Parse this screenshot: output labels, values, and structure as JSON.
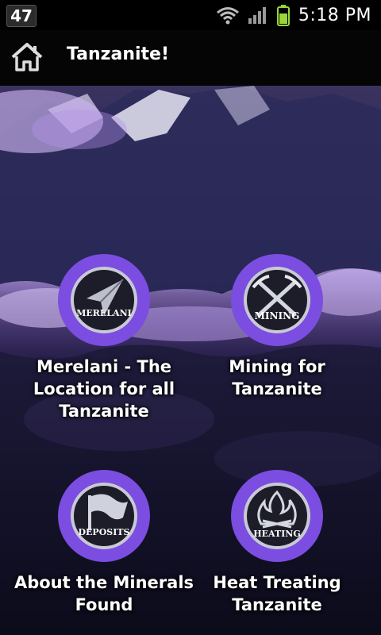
{
  "status_bar": {
    "notification_count": "47",
    "time": "5:18 PM",
    "icons": [
      "wifi-icon",
      "signal-icon",
      "battery-icon"
    ]
  },
  "action_bar": {
    "title": "Tanzanite!",
    "home_icon": "home-icon"
  },
  "colors": {
    "accent_purple": "#6a3ccf",
    "ring_purple": "#7b4de0",
    "emblem_dark": "#1d1d2a"
  },
  "tiles": [
    {
      "emblem_text": "MERELANI",
      "label": "Merelani - The Location for all Tanzanite",
      "icon": "paper-plane-icon"
    },
    {
      "emblem_text": "MINING",
      "label": "Mining for Tanzanite",
      "icon": "pickaxe-icon"
    },
    {
      "emblem_text": "DEPOSITS",
      "label": "About the Minerals Found",
      "icon": "flag-icon"
    },
    {
      "emblem_text": "HEATING",
      "label": "Heat Treating Tanzanite",
      "icon": "flame-icon"
    }
  ]
}
